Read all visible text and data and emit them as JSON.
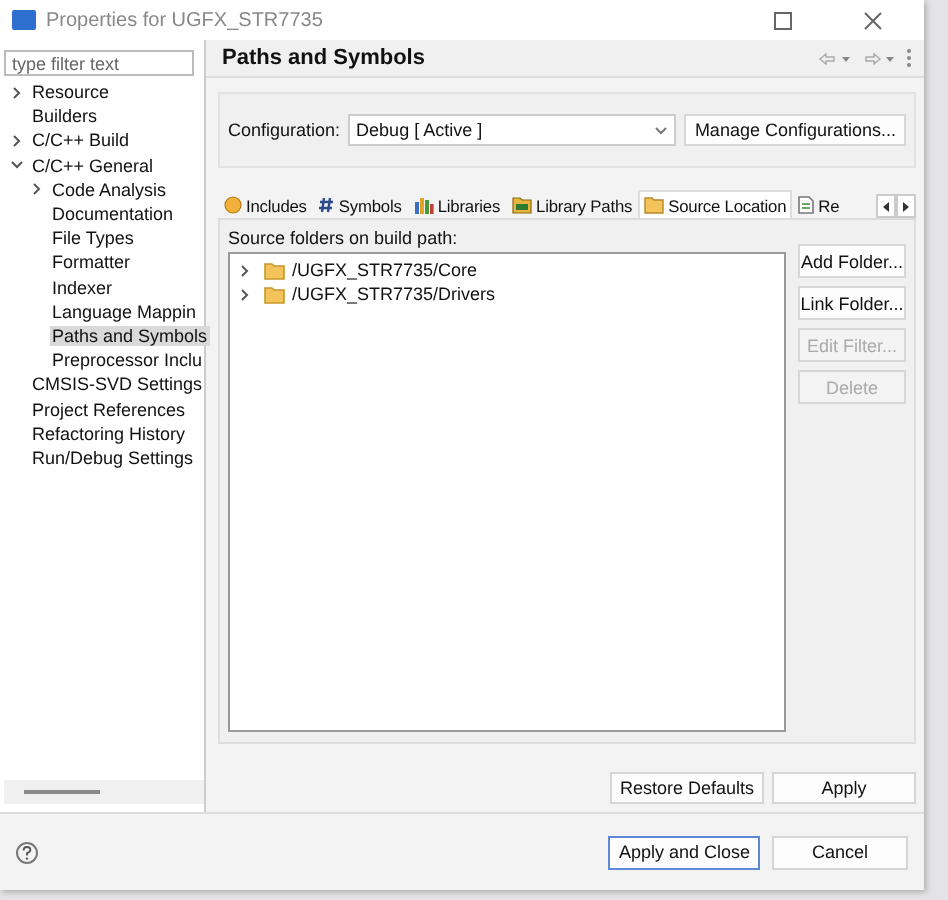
{
  "window": {
    "title": "Properties for UGFX_STR7735"
  },
  "filter": {
    "placeholder": "type filter text"
  },
  "sidebar": {
    "items": [
      {
        "label": "Resource",
        "expanded": false,
        "selected": false
      },
      {
        "label": "Builders",
        "selected": false
      },
      {
        "label": "C/C++ Build",
        "expanded": false,
        "selected": false
      },
      {
        "label": "C/C++ General",
        "expanded": true,
        "selected": false,
        "children": [
          {
            "label": "Code Analysis",
            "expanded": false,
            "selected": false
          },
          {
            "label": "Documentation",
            "selected": false
          },
          {
            "label": "File Types",
            "selected": false
          },
          {
            "label": "Formatter",
            "selected": false
          },
          {
            "label": "Indexer",
            "selected": false
          },
          {
            "label": "Language Mappin",
            "selected": false
          },
          {
            "label": "Paths and Symbols",
            "selected": true
          },
          {
            "label": "Preprocessor Inclu",
            "selected": false
          }
        ]
      },
      {
        "label": "CMSIS-SVD Settings",
        "selected": false
      },
      {
        "label": "Project References",
        "selected": false
      },
      {
        "label": "Refactoring History",
        "selected": false
      },
      {
        "label": "Run/Debug Settings",
        "selected": false
      }
    ]
  },
  "page": {
    "title": "Paths and Symbols",
    "configuration": {
      "label": "Configuration:",
      "value": "Debug  [ Active ]",
      "button": "Manage Configurations..."
    },
    "tabs": [
      {
        "label": "Includes",
        "selected": false
      },
      {
        "label": "Symbols",
        "selected": false
      },
      {
        "label": "Libraries",
        "selected": false
      },
      {
        "label": "Library Paths",
        "selected": false
      },
      {
        "label": "Source Location",
        "selected": true
      },
      {
        "label": "Re",
        "selected": false
      }
    ],
    "list_label": "Source folders on build path:",
    "folders": [
      {
        "label": "/UGFX_STR7735/Core",
        "expanded": false
      },
      {
        "label": "/UGFX_STR7735/Drivers",
        "expanded": false
      }
    ],
    "side_buttons": [
      {
        "label": "Add Folder...",
        "disabled": false
      },
      {
        "label": "Link Folder...",
        "disabled": false
      },
      {
        "label": "Edit Filter...",
        "disabled": true
      },
      {
        "label": "Delete",
        "disabled": true
      }
    ],
    "page_buttons": [
      "Restore Defaults",
      "Apply"
    ]
  },
  "footer_buttons": [
    {
      "label": "Apply and Close",
      "default": true
    },
    {
      "label": "Cancel",
      "default": false
    }
  ]
}
